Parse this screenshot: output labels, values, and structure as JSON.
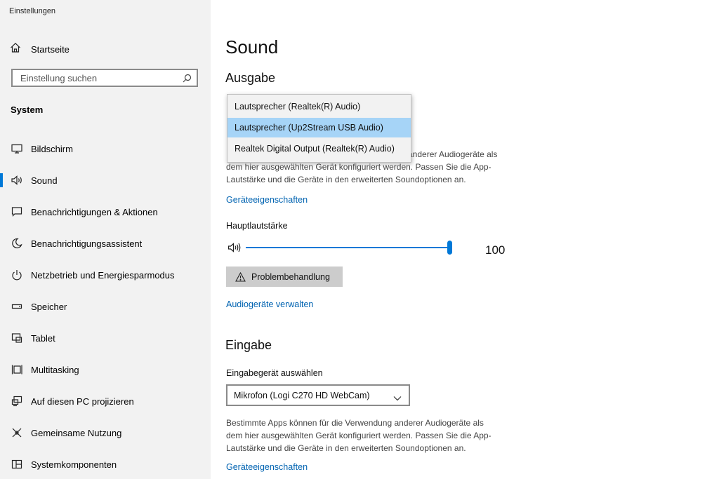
{
  "app": {
    "title": "Einstellungen"
  },
  "sidebar": {
    "home_label": "Startseite",
    "search_placeholder": "Einstellung suchen",
    "section": "System",
    "items": [
      {
        "label": "Bildschirm",
        "icon": "monitor-icon"
      },
      {
        "label": "Sound",
        "icon": "speaker-icon",
        "active": true
      },
      {
        "label": "Benachrichtigungen & Aktionen",
        "icon": "notification-icon"
      },
      {
        "label": "Benachrichtigungsassistent",
        "icon": "moon-icon"
      },
      {
        "label": "Netzbetrieb und Energiesparmodus",
        "icon": "power-icon"
      },
      {
        "label": "Speicher",
        "icon": "storage-icon"
      },
      {
        "label": "Tablet",
        "icon": "tablet-icon"
      },
      {
        "label": "Multitasking",
        "icon": "multitasking-icon"
      },
      {
        "label": "Auf diesen PC projizieren",
        "icon": "project-icon"
      },
      {
        "label": "Gemeinsame Nutzung",
        "icon": "share-icon"
      },
      {
        "label": "Systemkomponenten",
        "icon": "components-icon"
      }
    ]
  },
  "main": {
    "title": "Sound",
    "output": {
      "heading": "Ausgabe",
      "dropdown_options": [
        "Lautsprecher (Realtek(R) Audio)",
        "Lautsprecher (Up2Stream USB Audio)",
        "Realtek Digital Output (Realtek(R) Audio)"
      ],
      "selected_index": 1,
      "description_partial": [
        "anderer Audiogeräte als",
        "dem hier ausgewählten Gerät konfiguriert werden. Passen Sie die App-",
        "Lautstärke und die Geräte in den erweiterten Soundoptionen an."
      ],
      "device_props_link": "Geräteeigenschaften",
      "volume_label": "Hauptlautstärke",
      "volume_value": "100",
      "volume_level": 100,
      "troubleshoot_button": "Problembehandlung",
      "manage_devices_link": "Audiogeräte verwalten"
    },
    "input": {
      "heading": "Eingabe",
      "select_label": "Eingabegerät auswählen",
      "selected_device": "Mikrofon (Logi C270 HD WebCam)",
      "description": [
        "Bestimmte Apps können für die Verwendung anderer Audiogeräte als",
        "dem hier ausgewählten Gerät konfiguriert werden. Passen Sie die App-",
        "Lautstärke und die Geräte in den erweiterten Soundoptionen an."
      ],
      "device_props_link": "Geräteeigenschaften"
    }
  },
  "colors": {
    "accent": "#0078d7",
    "link": "#0063b1",
    "sidebar_bg": "#f2f2f2",
    "selection": "#a6d4f7"
  }
}
